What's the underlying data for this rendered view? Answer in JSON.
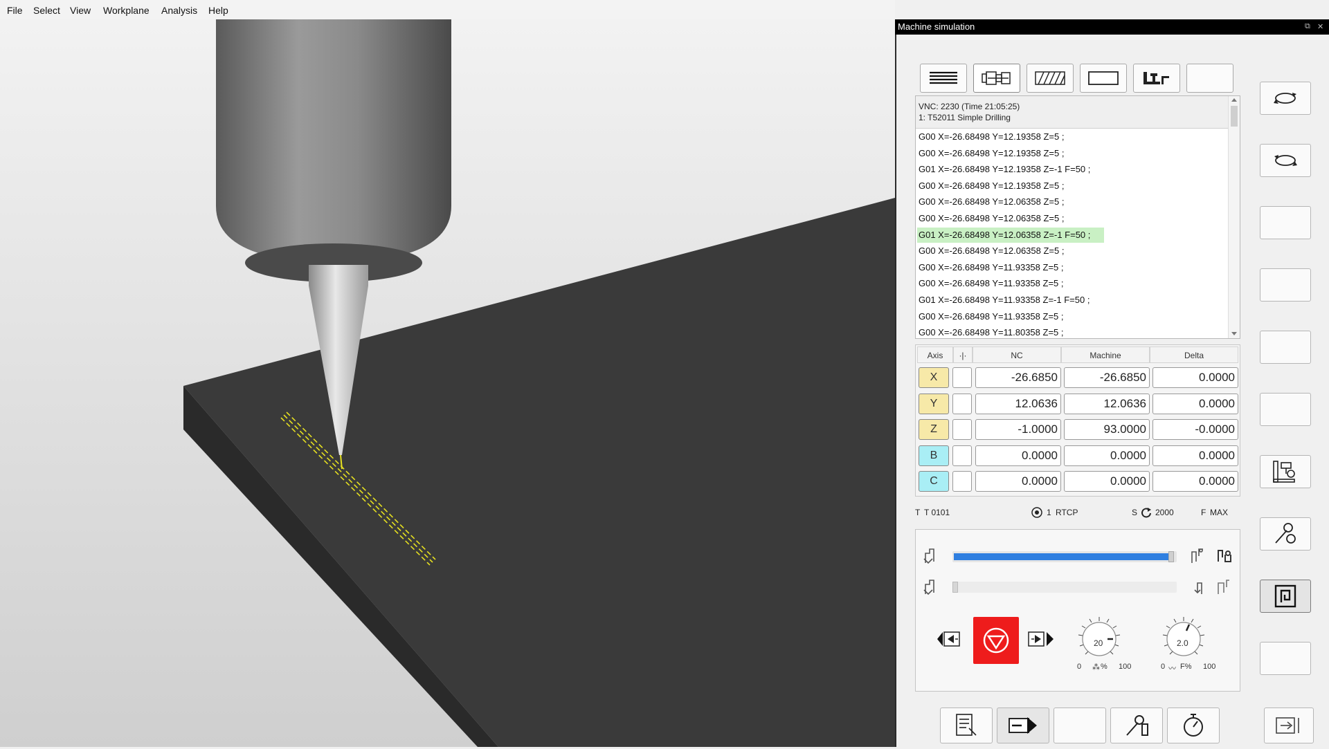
{
  "menu": [
    "File",
    "Select",
    "View",
    "Workplane",
    "Analysis",
    "Help"
  ],
  "panel": {
    "title": "Machine simulation",
    "window_buttons": [
      "restore-icon",
      "close-icon"
    ],
    "top_toolbar": [
      "nc-lines-icon",
      "tool-view-icon",
      "stock-hatch-icon",
      "blank-view-icon",
      "machine-icon",
      "empty-slot"
    ],
    "side_buttons": [
      "rotate-ccw-icon",
      "rotate-cw-icon",
      "empty",
      "empty",
      "empty",
      "empty",
      "machine-setup-icon",
      "tool-settings-icon",
      "spiral-icon",
      "empty"
    ],
    "bottom_buttons": [
      "report-icon",
      "step-forward-icon",
      "empty",
      "tool-measure-icon",
      "timer-icon"
    ],
    "exit_button": "exit-icon"
  },
  "program": {
    "header_line1": "VNC: 2230 (Time 21:05:25)",
    "header_line2": "1: T52011 Simple Drilling",
    "lines": [
      "G00 X=-26.68498 Y=12.19358 Z=5 ;",
      "G00 X=-26.68498 Y=12.19358 Z=5 ;",
      "G01 X=-26.68498 Y=12.19358 Z=-1 F=50 ;",
      "G00 X=-26.68498 Y=12.19358 Z=5 ;",
      "G00 X=-26.68498 Y=12.06358 Z=5 ;",
      "G00 X=-26.68498 Y=12.06358 Z=5 ;",
      "G01 X=-26.68498 Y=12.06358 Z=-1 F=50 ;",
      "G00 X=-26.68498 Y=12.06358 Z=5 ;",
      "G00 X=-26.68498 Y=11.93358 Z=5 ;",
      "G00 X=-26.68498 Y=11.93358 Z=5 ;",
      "G01 X=-26.68498 Y=11.93358 Z=-1 F=50 ;",
      "G00 X=-26.68498 Y=11.93358 Z=5 ;",
      "G00 X=-26.68498 Y=11.80358 Z=5 ;"
    ],
    "highlighted_index": 6,
    "highlight_color": "#c9f0c4"
  },
  "axes": {
    "headers": {
      "axis": "Axis",
      "nc": "NC",
      "machine": "Machine",
      "delta": "Delta"
    },
    "rows": [
      {
        "axis": "X",
        "nc": "-26.6850",
        "machine": "-26.6850",
        "delta": "0.0000",
        "color": "#f7e9a8"
      },
      {
        "axis": "Y",
        "nc": "12.0636",
        "machine": "12.0636",
        "delta": "0.0000",
        "color": "#f7e9a8"
      },
      {
        "axis": "Z",
        "nc": "-1.0000",
        "machine": "93.0000",
        "delta": "-0.0000",
        "color": "#f7e9a8"
      },
      {
        "axis": "B",
        "nc": "0.0000",
        "machine": "0.0000",
        "delta": "0.0000",
        "color": "#a9eef5"
      },
      {
        "axis": "C",
        "nc": "0.0000",
        "machine": "0.0000",
        "delta": "0.0000",
        "color": "#a9eef5"
      }
    ]
  },
  "status": {
    "tool_label": "T",
    "tool_value": "T 0101",
    "rtcp_num": "1",
    "rtcp_label": "RTCP",
    "spindle_label": "S",
    "spindle_value": "2000",
    "feed_label": "F",
    "feed_value": "MAX"
  },
  "control": {
    "progress_fraction": 1.0,
    "step_fraction": 0.0,
    "accent": "#2f7fe0",
    "stop_color": "#ee1c1c",
    "speed_dial": {
      "value": "20",
      "min": "0",
      "max": "100",
      "unit": "%"
    },
    "feed_dial": {
      "value": "2.0",
      "min": "0",
      "max": "100",
      "unit": "F%"
    }
  }
}
